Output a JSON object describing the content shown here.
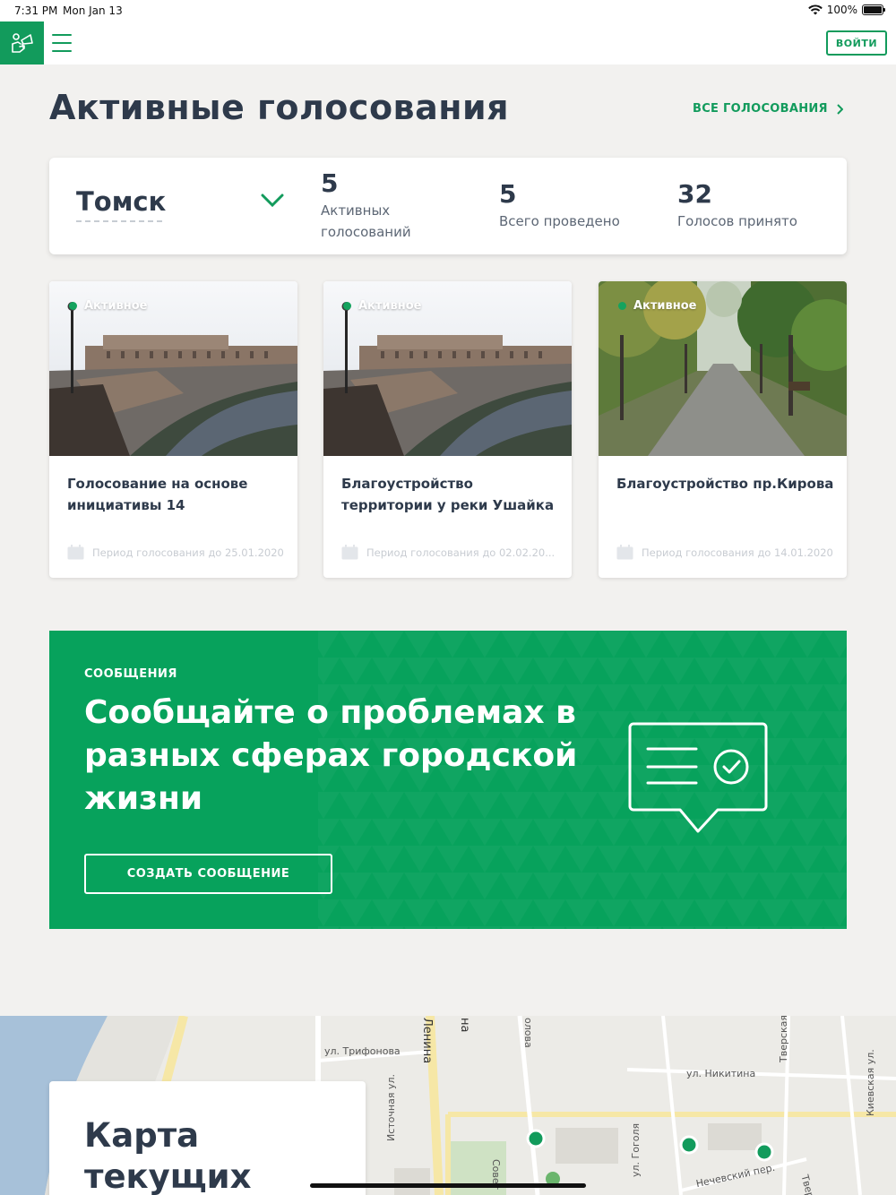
{
  "status_bar": {
    "time": "7:31 PM",
    "date": "Mon Jan 13",
    "battery": "100%"
  },
  "header": {
    "logo_icon": "megaphone-hand-icon",
    "menu_icon": "hamburger-icon",
    "login_label": "ВОЙТИ"
  },
  "colors": {
    "brand": "#129b5c",
    "banner": "#07a25c",
    "text": "#2e3a4b",
    "background": "#f2f1ef"
  },
  "votings": {
    "title": "Активные голосования",
    "all_link": "ВСЕ ГОЛОСОВАНИЯ",
    "city": "Томск",
    "stats": [
      {
        "value": "5",
        "label": "Активных голосований"
      },
      {
        "value": "5",
        "label": "Всего проведено"
      },
      {
        "value": "32",
        "label": "Голосов принято"
      }
    ],
    "cards": [
      {
        "status": "Активное",
        "title": "Голосование на основе инициативы 14",
        "period": "Период голосования до 25.01.2020"
      },
      {
        "status": "Активное",
        "title": "Благоустройство территории у реки Ушайка",
        "period": "Период голосования до 02.02.20..."
      },
      {
        "status": "Активное",
        "title": "Благоустройство пр.Кирова",
        "period": "Период голосования до 14.01.2020"
      }
    ]
  },
  "messages": {
    "kicker": "СООБЩЕНИЯ",
    "heading": "Сообщайте о проблемах в разных сферах городской жизни",
    "button": "СОЗДАТЬ СООБЩЕНИЕ"
  },
  "map": {
    "title_line1": "Карта",
    "title_line2": "текущих",
    "streets": [
      "ул. Трифонова",
      "Ленина",
      "на",
      "олова",
      "Источная ул.",
      "ул. Никитина",
      "Тверская",
      "Киевская ул.",
      "ул. Гоголя",
      "Нечевский пер.",
      "Совет",
      "Твер"
    ]
  }
}
